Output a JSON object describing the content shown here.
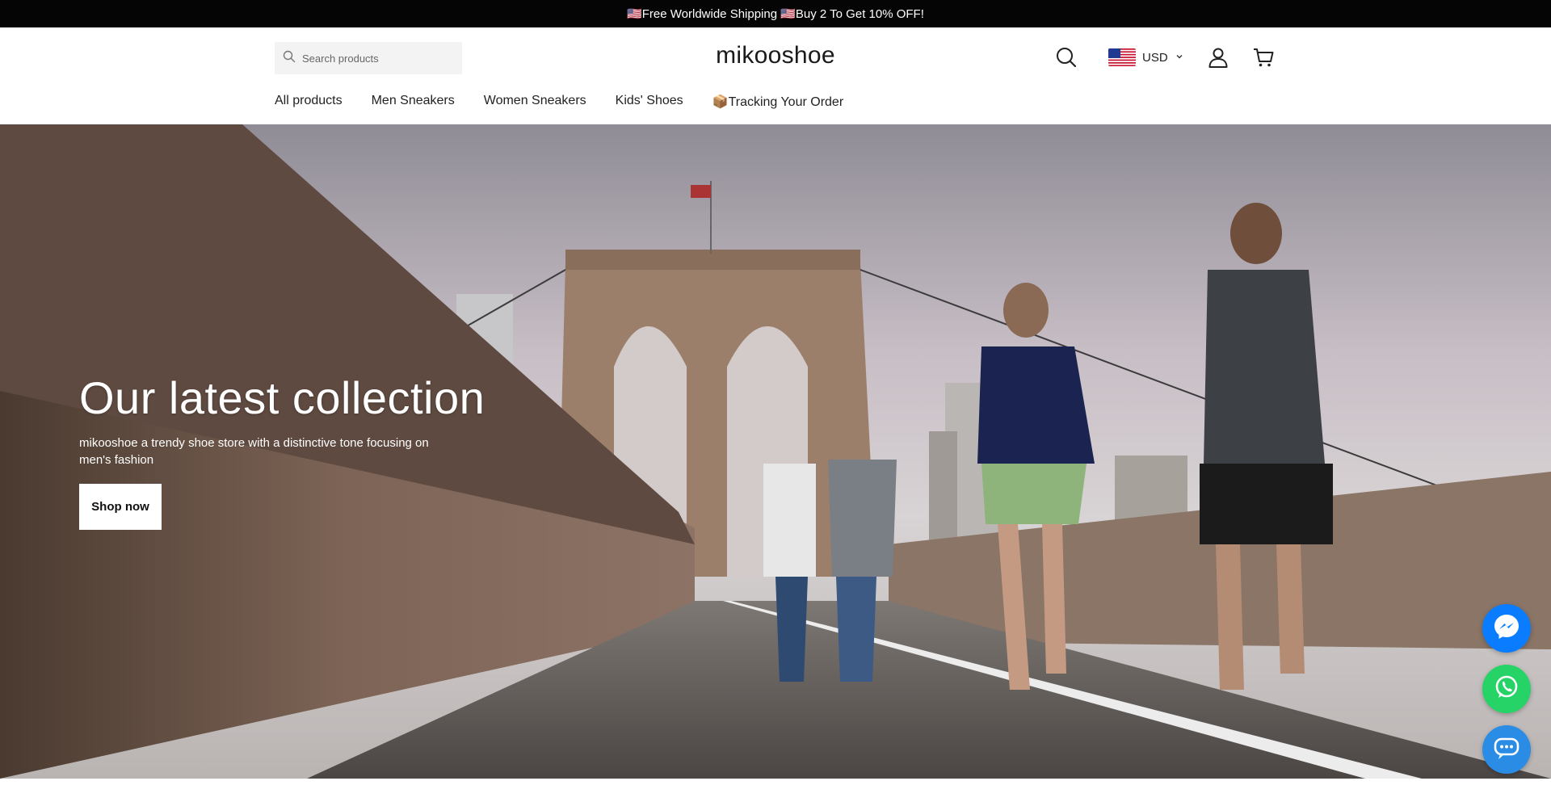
{
  "announcement": {
    "text": "🇺🇸Free Worldwide Shipping 🇺🇸Buy 2 To Get 10% OFF!"
  },
  "header": {
    "search_placeholder": "Search products",
    "logo": "mikooshoe",
    "currency": "USD",
    "icons": [
      "search-icon",
      "us-flag-icon",
      "chevron-down-icon",
      "account-icon",
      "cart-icon"
    ]
  },
  "nav": {
    "items": [
      {
        "label": "All products"
      },
      {
        "label": "Men Sneakers"
      },
      {
        "label": "Women Sneakers"
      },
      {
        "label": "Kids' Shoes"
      },
      {
        "label": "📦Tracking Your Order"
      }
    ]
  },
  "hero": {
    "title": "Our latest collection",
    "subtitle": "mikooshoe a trendy shoe store with a distinctive tone focusing on men's fashion",
    "button_label": "Shop now"
  },
  "floating": {
    "icons": [
      "messenger-icon",
      "whatsapp-icon",
      "live-chat-icon"
    ],
    "colors": {
      "messenger": "#0a7cff",
      "whatsapp": "#25d366",
      "chat": "#2b8ce6"
    }
  },
  "colors": {
    "announcement_bg": "#050505",
    "header_bg": "#ffffff",
    "search_bg": "#f3f3f3",
    "button_bg": "#ffffff"
  }
}
